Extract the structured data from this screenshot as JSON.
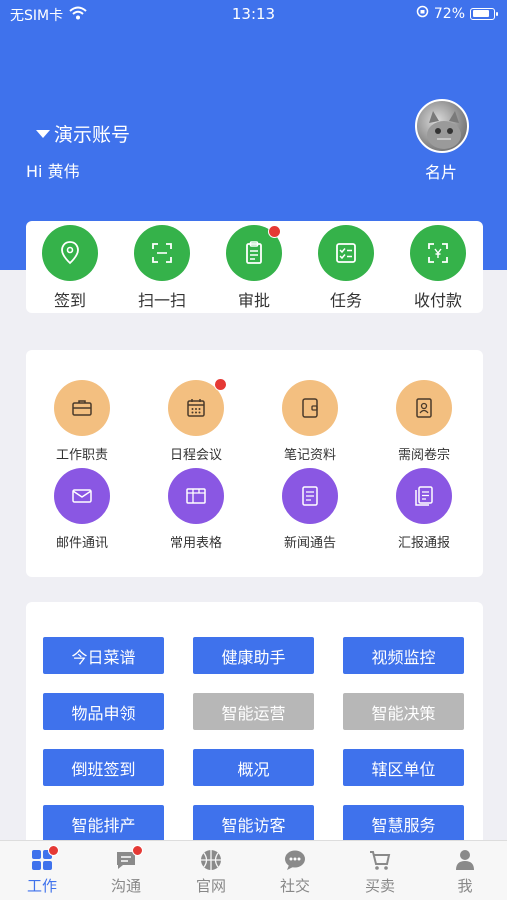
{
  "status": {
    "carrier": "无SIM卡",
    "time": "13:13",
    "battery": "72%"
  },
  "header": {
    "account": "演示账号",
    "greeting": "Hi 黄伟",
    "card_link": "名片"
  },
  "quick_actions": [
    {
      "label": "签到",
      "icon": "location-pin-icon"
    },
    {
      "label": "扫一扫",
      "icon": "scan-icon"
    },
    {
      "label": "审批",
      "icon": "clipboard-icon",
      "badge": true
    },
    {
      "label": "任务",
      "icon": "checklist-icon"
    },
    {
      "label": "收付款",
      "icon": "payment-icon"
    }
  ],
  "modules": [
    {
      "label": "工作职责",
      "icon": "briefcase-icon",
      "color": "orange"
    },
    {
      "label": "日程会议",
      "icon": "calendar-icon",
      "color": "orange",
      "badge": true
    },
    {
      "label": "笔记资料",
      "icon": "notebook-icon",
      "color": "orange"
    },
    {
      "label": "需阅卷宗",
      "icon": "dossier-icon",
      "color": "orange"
    },
    {
      "label": "邮件通讯",
      "icon": "mail-icon",
      "color": "purple"
    },
    {
      "label": "常用表格",
      "icon": "table-icon",
      "color": "purple"
    },
    {
      "label": "新闻通告",
      "icon": "news-icon",
      "color": "purple"
    },
    {
      "label": "汇报通报",
      "icon": "report-icon",
      "color": "purple"
    }
  ],
  "functions": [
    {
      "label": "今日菜谱",
      "enabled": true
    },
    {
      "label": "健康助手",
      "enabled": true
    },
    {
      "label": "视频监控",
      "enabled": true
    },
    {
      "label": "物品申领",
      "enabled": true
    },
    {
      "label": "智能运营",
      "enabled": false
    },
    {
      "label": "智能决策",
      "enabled": false
    },
    {
      "label": "倒班签到",
      "enabled": true
    },
    {
      "label": "概况",
      "enabled": true
    },
    {
      "label": "辖区单位",
      "enabled": true
    },
    {
      "label": "智能排产",
      "enabled": true
    },
    {
      "label": "智能访客",
      "enabled": true
    },
    {
      "label": "智慧服务",
      "enabled": true
    }
  ],
  "tabs": [
    {
      "label": "工作",
      "active": true,
      "badge": true
    },
    {
      "label": "沟通",
      "active": false,
      "badge": true
    },
    {
      "label": "官网",
      "active": false
    },
    {
      "label": "社交",
      "active": false
    },
    {
      "label": "买卖",
      "active": false
    },
    {
      "label": "我",
      "active": false
    }
  ],
  "colors": {
    "primary": "#3f72ec",
    "green": "#35b24a",
    "orange": "#f3bf80",
    "purple": "#8a57e3",
    "disabled": "#b7b7b7",
    "badge": "#e53935"
  }
}
